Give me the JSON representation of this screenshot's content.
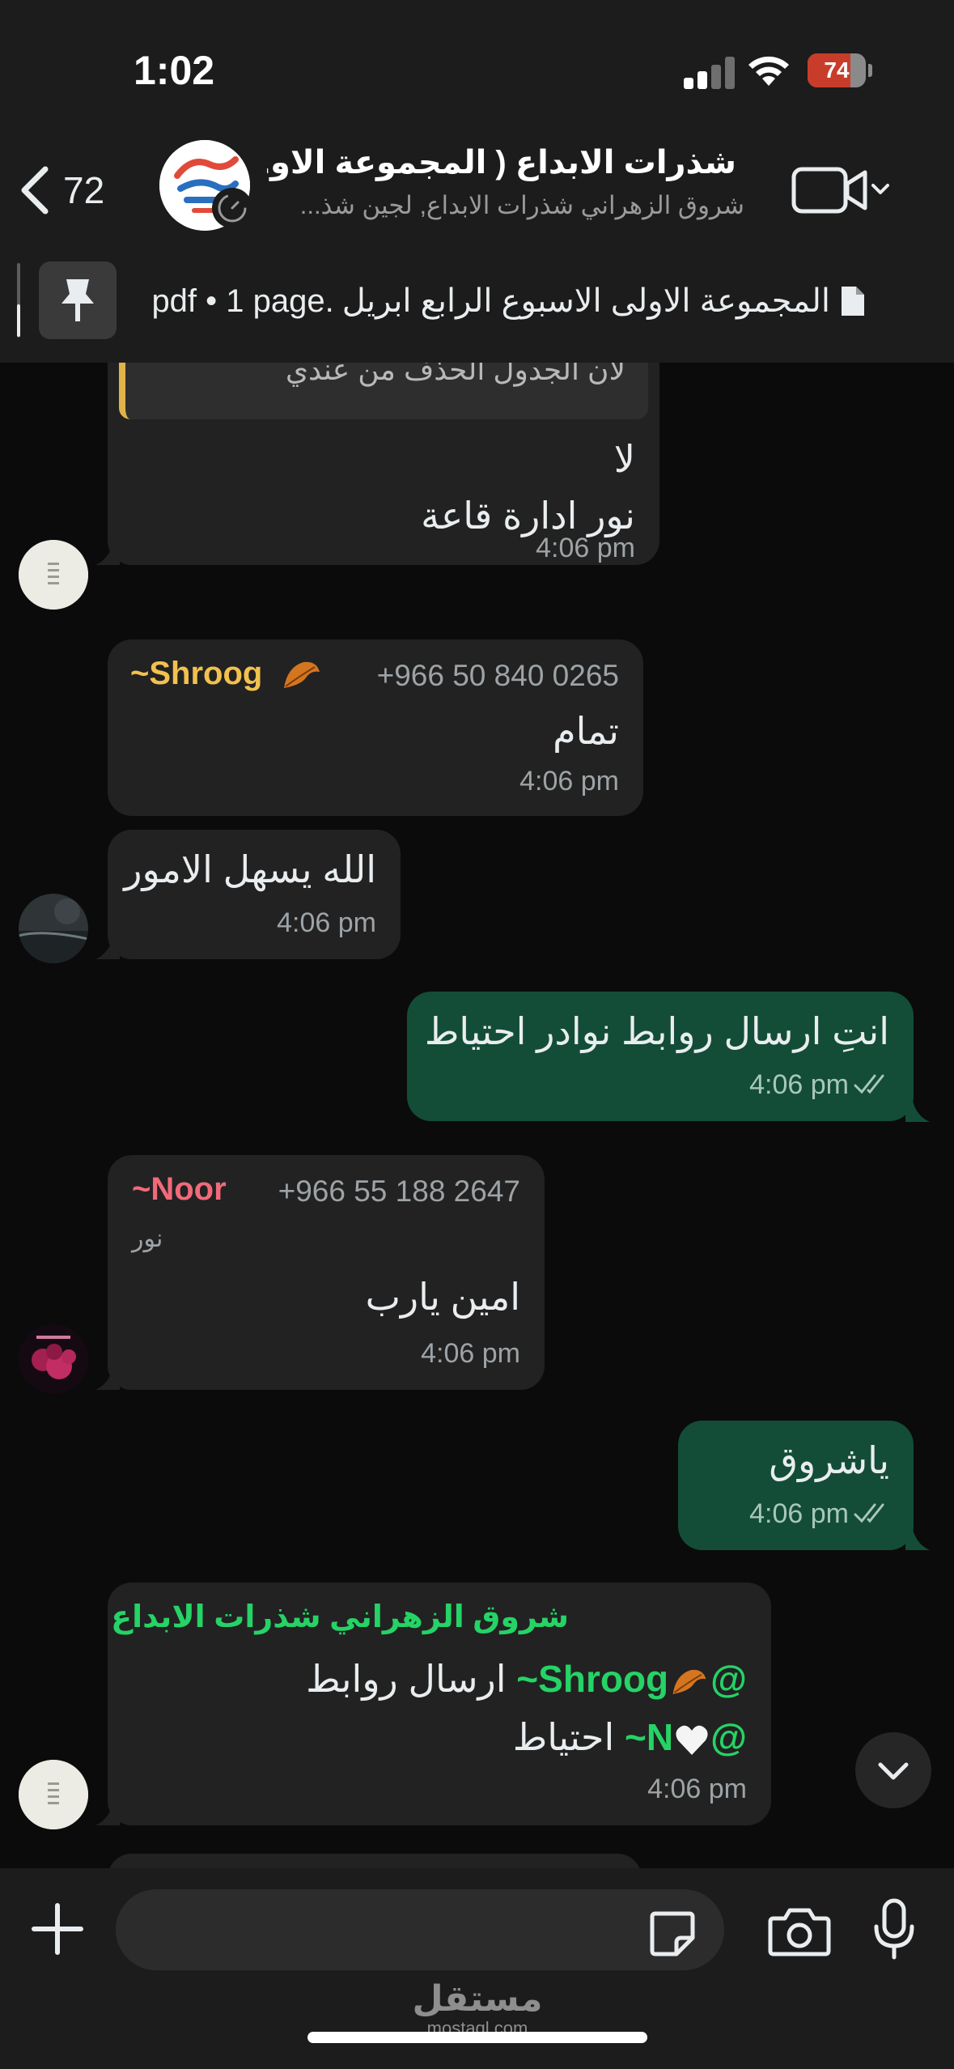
{
  "status_bar": {
    "time": "1:02",
    "battery": "74",
    "battery_level": 0.74
  },
  "header": {
    "back_count": "72",
    "title": "شذرات الابداع ( المجموعة الاو...",
    "subtitle": "شروق الزهراني شذرات الابداع, لجين شذ..."
  },
  "pinned": {
    "prefix": "pdf • 1 page.",
    "filename": "المجموعة الاولى الاسبوع الرابع ابريل"
  },
  "messages": {
    "m1": {
      "quote": "لان الجدول الحذف من عندي",
      "line1": "لا",
      "line2": "نور ادارة قاعة",
      "time": "4:06 pm"
    },
    "m2": {
      "sender": "~Shroog",
      "phone": "+966 50 840 0265",
      "text": "تمام",
      "time": "4:06 pm"
    },
    "m3": {
      "text": "الله يسهل الامور",
      "time": "4:06 pm"
    },
    "m4": {
      "text": "انتِ ارسال روابط نوادر احتياط",
      "time": "4:06 pm"
    },
    "m5": {
      "sender": "~Noor",
      "phone": "+966 55 188 2647",
      "sub": "نور",
      "text": "امين يارب",
      "time": "4:06 pm"
    },
    "m6": {
      "text": "ياشروق",
      "time": "4:06 pm"
    },
    "m7": {
      "sender": "شروق الزهراني شذرات الابداع",
      "mention1": "~Shroog",
      "text1": "ارسال روابط",
      "mention2": "~N",
      "text2": "احتياط",
      "time": "4:06 pm"
    }
  },
  "input": {
    "placeholder": ""
  },
  "watermark": {
    "ar": "مستقل",
    "en": "mostaql.com"
  },
  "colors": {
    "accent_green": "#25d366",
    "outgoing_bubble": "#134d37",
    "incoming_bubble": "#222222",
    "shroog_name": "#f2c14e",
    "noor_name": "#f16a7a"
  }
}
